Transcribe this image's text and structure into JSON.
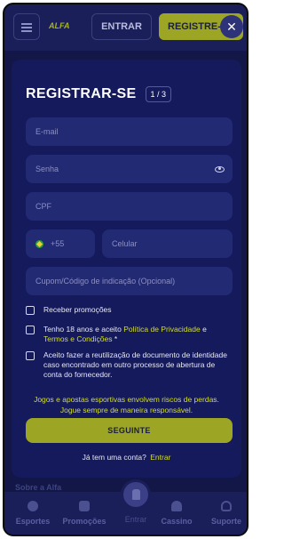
{
  "header": {
    "logo": "ALFA",
    "login_label": "ENTRAR",
    "register_label": "REGISTRE-",
    "close_symbol": "✕"
  },
  "modal": {
    "title": "REGISTRAR-SE",
    "step": "1 / 3",
    "fields": {
      "email_placeholder": "E-mail",
      "password_placeholder": "Senha",
      "cpf_placeholder": "CPF",
      "country_code": "+55",
      "phone_placeholder": "Celular",
      "referral_placeholder": "Cupom/Código de indicação (Opcional)"
    },
    "checkboxes": {
      "promotions": "Receber promoções",
      "age_prefix": "Tenho 18 anos e aceito ",
      "privacy_link": "Política de Privacidade",
      "age_middle": " e ",
      "terms_link": "Termos e Condições",
      "age_suffix": " *",
      "reuse_docs": "Aceito fazer a reutilização de documento de identidade caso encontrado em outro processo de abertura de conta do fornecedor."
    },
    "notice_line1": "Jogos e apostas esportivas envolvem riscos de perdas.",
    "notice_line2": "Jogue sempre de maneira responsável.",
    "next_label": "SEGUINTE",
    "have_account": "Já tem uma conta?",
    "login_link": "Entrar"
  },
  "background": {
    "about_label": "Sobre a Alfa"
  },
  "bottom_nav": {
    "items": [
      {
        "label": "Esportes",
        "icon": "soccer-ball-icon"
      },
      {
        "label": "Promoções",
        "icon": "gift-icon"
      },
      {
        "label": "Entrar",
        "icon": "user-icon"
      },
      {
        "label": "Cassino",
        "icon": "spade-icon"
      },
      {
        "label": "Suporte",
        "icon": "headset-icon"
      }
    ]
  },
  "colors": {
    "accent": "#9da624",
    "link": "#d4de2a",
    "modal_bg": "#141a5c",
    "field_bg": "#232a74"
  }
}
